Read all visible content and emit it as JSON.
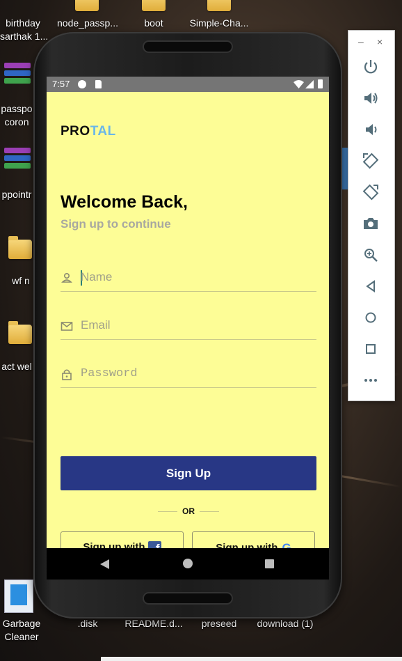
{
  "desktop": {
    "icons": [
      {
        "label": "birthday\nsarthak 1..."
      },
      {
        "label": "node_passp..."
      },
      {
        "label": "boot"
      },
      {
        "label": "Simple-Cha..."
      },
      {
        "label": "passpo\ncoron"
      },
      {
        "label": "ppointr"
      },
      {
        "label": "wf n"
      },
      {
        "label": "act wel"
      },
      {
        "label": "Garbage\nCleaner"
      },
      {
        "label": ".disk"
      },
      {
        "label": "README.d..."
      },
      {
        "label": "preseed"
      },
      {
        "label": "download (1)"
      }
    ]
  },
  "status_bar": {
    "time": "7:57"
  },
  "app": {
    "logo_part1": "PRO",
    "logo_part2": "TAL",
    "welcome": "Welcome Back,",
    "subtitle": "Sign up to continue",
    "fields": {
      "name_placeholder": "Name",
      "email_placeholder": "Email",
      "password_placeholder": "Password"
    },
    "signup_label": "Sign Up",
    "or_label": "OR",
    "facebook_label": "Sign up with",
    "google_label": "Sign up with"
  },
  "colors": {
    "screen_bg": "#fdfd96",
    "primary_button": "#283785",
    "logo_accent": "#6ab7e8"
  },
  "emulator_panel": {
    "minimize": "–",
    "close": "×",
    "buttons": [
      "power-icon",
      "volume-up-icon",
      "volume-down-icon",
      "rotate-left-icon",
      "rotate-right-icon",
      "camera-icon",
      "zoom-icon",
      "back-icon",
      "home-icon",
      "overview-icon",
      "more-icon"
    ]
  }
}
